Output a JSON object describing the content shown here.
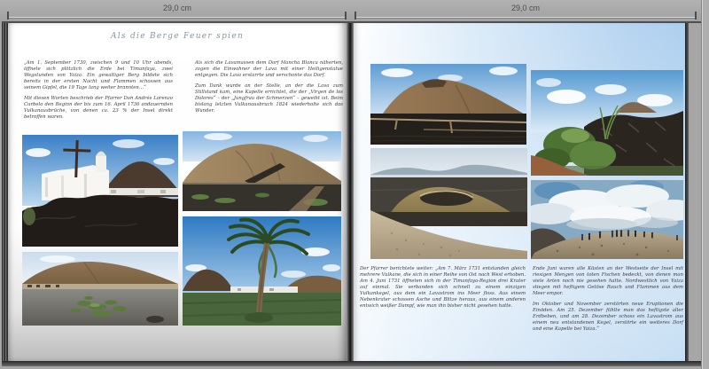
{
  "rulers": {
    "left": "29,0 cm",
    "right": "29,0 cm"
  },
  "left_page": {
    "title": "Als die Berge Feuer spien",
    "column1": {
      "p1": "„Am 1. September 1730, zwischen 9 und 10 Uhr abends, öffnete sich plötzlich die Erde bei Timanfaya, zwei Wegstunden von Yaiza. Ein gewaltiger Berg bildete sich bereits in der ersten Nacht und Flammen schossen aus seinem Gipfel, die 19 Tage lang weiter brannten…“",
      "p2": "Mit diesen Worten beschrieb der Pfarrer Don Andrés Lorenzo Curbelo den Beginn der bis zum 16. April 1736 andauernden Vulkanausbrüche, von denen ca. 23 % der Insel direkt betroffen waren."
    },
    "column2": {
      "p1": "Als sich die Lavamassen dem Dorf Mancha Blanca näherten, zogen die Einwohner der Lava mit einer Heiligenstatue entgegen. Die Lava erstarrte und verschonte das Dorf.",
      "p2": "Zum Dank wurde an der Stelle, an der die Lava zum Stillstand kam, eine Kapelle errichtet, die der „Virgen de los Dolores“ – der „Jungfrau der Schmerzen“ – geweiht ist. Beim bislang letzten Vulkanausbruch 1824 wiederholte sich das Wunder."
    },
    "photos": [
      "church-cross-lava",
      "volcano-farm-fields",
      "ash-field-plants",
      "palm-tree-volcanoes"
    ]
  },
  "right_page": {
    "column1": {
      "p1": "Der Pfarrer berichtete weiter: „Am 7. März 1731 entstanden gleich mehrere Vulkane, die sich in einer Reihe von Ost nach West erhoben. Am 4. Juni 1731 öffneten sich in der Timanfaya-Region drei Krater auf einmal. Sie verbanden sich schnell zu einem einzigen Vulkankegel, aus dem ein Lavastrom ins Meer floss. Aus einem Nebenkrater schossen Asche und Blitze heraus, aus einem anderen entwich weißer Dampf, wie man ihn bisher nicht gesehen hatte."
    },
    "column2": {
      "p1": "Ende Juni waren alle Küsten an der Westseite der Insel mit riesigen Mengen von toten Fischen bedeckt, von denen man viele Arten noch nie gesehen hatte. Nordwestlich von Yaiza stiegen mit heftigem Getöse Rauch und Flammen aus dem Meer empor.",
      "p2": "Im Oktober und November zerstörten neue Eruptionen die Einöden. Am 25. Dezember fühlte man das heftigste aller Erdbeben, und am 28. Dezember schoss ein Lavastrom aus einem neu entstandenen Kegel, zerstörte ein weiteres Dorf und eine Kapelle bei Yaiza.“"
    },
    "photos": [
      "volcano-lava-walls",
      "lava-shrubs",
      "crater-panorama",
      "hikers-ridge"
    ]
  },
  "colors": {
    "workspace": "#a6a6a6",
    "ruler_text": "#4e4e4e",
    "page_left": "#ffffff",
    "page_right_sky": "#aecdeb",
    "body_text": "#3c3c3f",
    "title_text": "#8a939e"
  }
}
